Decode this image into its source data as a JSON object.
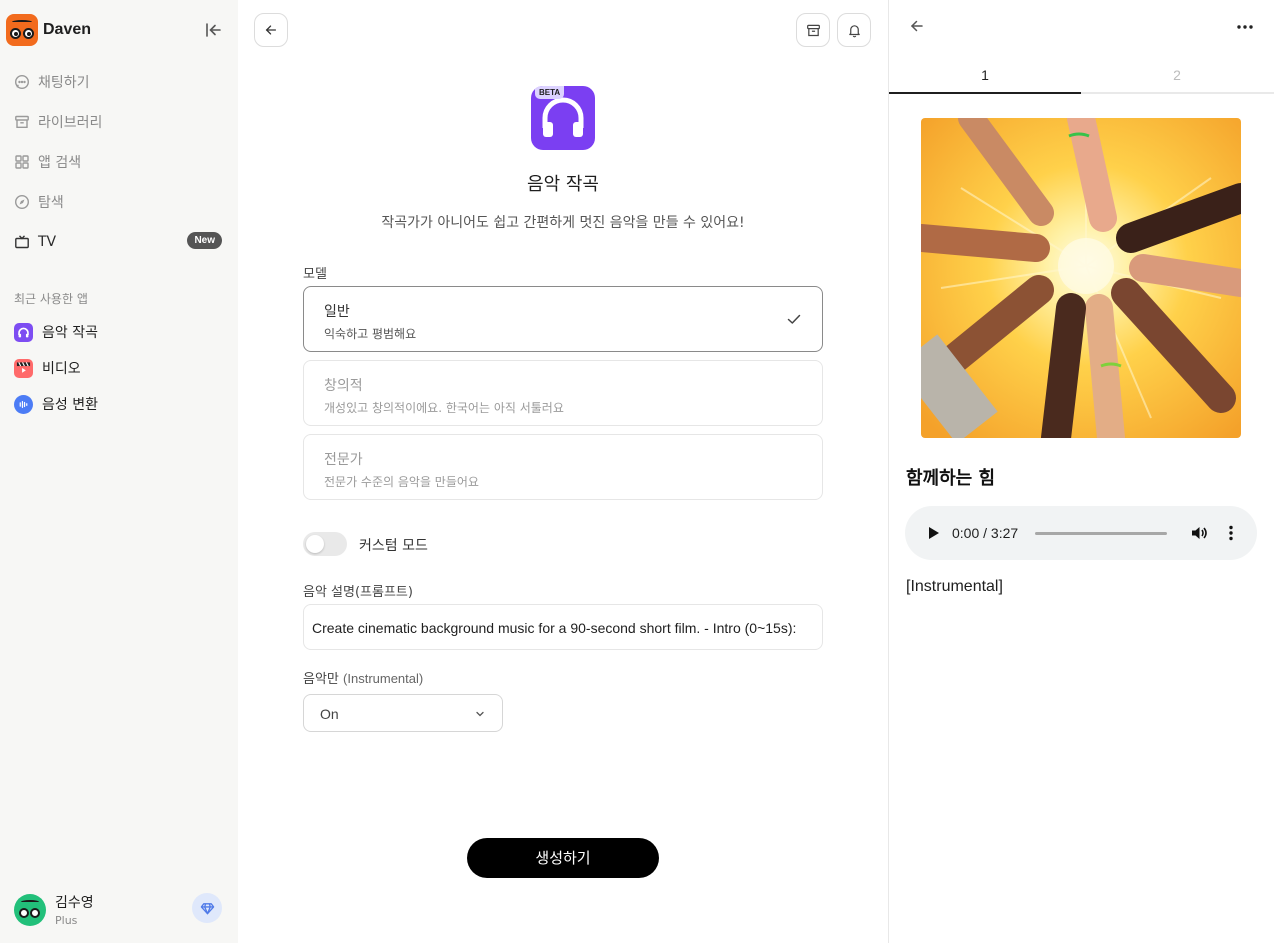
{
  "brand": {
    "name": "Daven",
    "accent": "#f26b1d"
  },
  "sidebar": {
    "nav": [
      {
        "label": "채팅하기",
        "icon": "chat-icon"
      },
      {
        "label": "라이브러리",
        "icon": "archive-icon"
      },
      {
        "label": "앱 검색",
        "icon": "grid-icon"
      },
      {
        "label": "탐색",
        "icon": "compass-icon"
      },
      {
        "label": "TV",
        "icon": "tv-icon",
        "badge": "New"
      }
    ],
    "recent_title": "최근 사용한 앱",
    "recent": [
      {
        "label": "음악 작곡",
        "icon": "headphones-icon"
      },
      {
        "label": "비디오",
        "icon": "clapperboard-icon"
      },
      {
        "label": "음성 변환",
        "icon": "voice-icon"
      }
    ],
    "user": {
      "name": "김수영",
      "plan": "Plus"
    }
  },
  "main": {
    "beta": "BETA",
    "title": "음악 작곡",
    "description": "작곡가가 아니어도 쉽고 간편하게 멋진 음악을 만들 수 있어요!",
    "model_label": "모델",
    "models": [
      {
        "title": "일반",
        "subtitle": "익숙하고 평범해요",
        "selected": true
      },
      {
        "title": "창의적",
        "subtitle": "개성있고 창의적이에요. 한국어는 아직 서툴러요",
        "selected": false
      },
      {
        "title": "전문가",
        "subtitle": "전문가 수준의 음악을 만들어요",
        "selected": false
      }
    ],
    "custom_mode_label": "커스텀 모드",
    "custom_mode_on": false,
    "prompt_label": "음악 설명(프롬프트)",
    "prompt_value": "Create cinematic background music for a 90-second short film. - Intro (0~15s):",
    "instrumental_label": "음악만",
    "instrumental_sub": "(Instrumental)",
    "instrumental_value": "On",
    "generate_label": "생성하기"
  },
  "panel": {
    "tabs": [
      "1",
      "2"
    ],
    "active_tab": "1",
    "song_title": "함께하는 힘",
    "time": "0:00 / 3:27",
    "progress": 0,
    "lyrics": "[Instrumental]"
  }
}
